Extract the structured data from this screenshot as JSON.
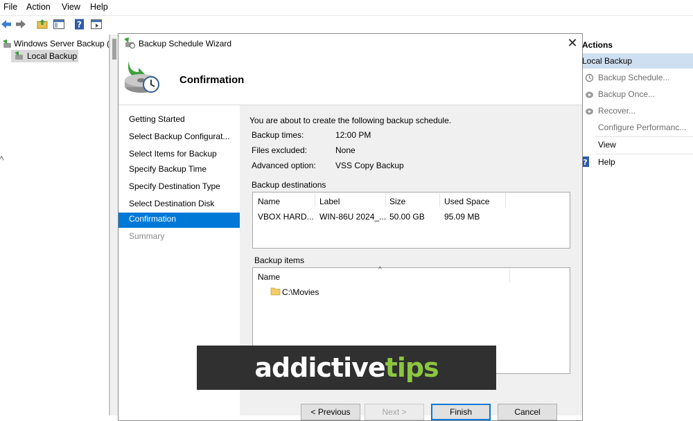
{
  "menu": {
    "file": "File",
    "action": "Action",
    "view": "View",
    "help": "Help"
  },
  "tree": {
    "root": "Windows Server Backup (L",
    "child": "Local Backup"
  },
  "actions": {
    "header": "Actions",
    "section": "Local Backup",
    "items": [
      {
        "label": "Backup Schedule...",
        "icon": "schedule-icon",
        "enabled": false
      },
      {
        "label": "Backup Once...",
        "icon": "backup-once-icon",
        "enabled": false
      },
      {
        "label": "Recover...",
        "icon": "recover-icon",
        "enabled": false
      },
      {
        "label": "Configure Performanc...",
        "icon": "",
        "enabled": false
      },
      {
        "label": "View",
        "icon": "",
        "enabled": true
      },
      {
        "label": "Help",
        "icon": "help-icon",
        "enabled": true
      }
    ]
  },
  "dialog": {
    "title": "Backup Schedule Wizard",
    "page_title": "Confirmation",
    "close": "✕",
    "nav": [
      {
        "label": "Getting Started",
        "state": "normal"
      },
      {
        "label": "Select Backup Configurat...",
        "state": "normal"
      },
      {
        "label": "Select Items for Backup",
        "state": "normal"
      },
      {
        "label": "Specify Backup Time",
        "state": "normal"
      },
      {
        "label": "Specify Destination Type",
        "state": "normal"
      },
      {
        "label": "Select Destination Disk",
        "state": "normal"
      },
      {
        "label": "Confirmation",
        "state": "active"
      },
      {
        "label": "Summary",
        "state": "disabled"
      }
    ],
    "intro": "You are about to create the following backup schedule.",
    "details": [
      {
        "label": "Backup times:",
        "value": "12:00 PM"
      },
      {
        "label": "Files excluded:",
        "value": "None"
      },
      {
        "label": "Advanced option:",
        "value": "VSS Copy Backup"
      }
    ],
    "destinations": {
      "heading": "Backup destinations",
      "columns": [
        "Name",
        "Label",
        "Size",
        "Used Space"
      ],
      "rows": [
        [
          "VBOX HARD...",
          "WIN-86U 2024_...",
          "50.00 GB",
          "95.09 MB"
        ]
      ]
    },
    "items": {
      "heading": "Backup items",
      "column": "Name",
      "rows": [
        "C:\\Movies"
      ]
    },
    "buttons": {
      "previous": "< Previous",
      "next": "Next >",
      "finish": "Finish",
      "cancel": "Cancel"
    }
  },
  "watermark": {
    "part1": "addictive",
    "part2": "tips"
  },
  "colors": {
    "accent": "#0078d7",
    "watermark_green": "#8cc63f",
    "watermark_bg": "#303030"
  }
}
